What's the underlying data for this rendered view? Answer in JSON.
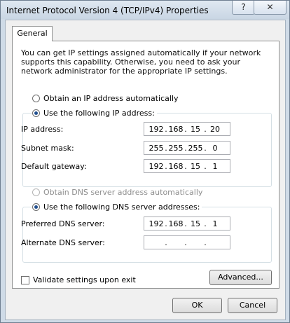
{
  "window": {
    "title": "Internet Protocol Version 4 (TCP/IPv4) Properties",
    "help_label": "?",
    "close_label": "✕"
  },
  "tabs": [
    {
      "label": "General"
    }
  ],
  "description": "You can get IP settings assigned automatically if your network supports this capability. Otherwise, you need to ask your network administrator for the appropriate IP settings.",
  "ip": {
    "auto_label": "Obtain an IP address automatically",
    "manual_label": "Use the following IP address:",
    "selected": "manual",
    "fields": [
      {
        "label": "IP address:",
        "octets": [
          "192",
          "168",
          "15",
          "20"
        ]
      },
      {
        "label": "Subnet mask:",
        "octets": [
          "255",
          "255",
          "255",
          "0"
        ]
      },
      {
        "label": "Default gateway:",
        "octets": [
          "192",
          "168",
          "15",
          "1"
        ]
      }
    ]
  },
  "dns": {
    "auto_label": "Obtain DNS server address automatically",
    "auto_disabled": true,
    "manual_label": "Use the following DNS server addresses:",
    "selected": "manual",
    "fields": [
      {
        "label": "Preferred DNS server:",
        "octets": [
          "192",
          "168",
          "15",
          "1"
        ]
      },
      {
        "label": "Alternate DNS server:",
        "octets": [
          "",
          "",
          "",
          ""
        ]
      }
    ]
  },
  "validate": {
    "label": "Validate settings upon exit",
    "checked": false
  },
  "buttons": {
    "advanced": "Advanced...",
    "ok": "OK",
    "cancel": "Cancel"
  },
  "icons": {
    "help": "help-icon",
    "close": "close-icon"
  },
  "colors": {
    "radio_dot": "#214f8e",
    "title_gradient_top": "#dfe8f1",
    "title_gradient_bottom": "#c9d6e4"
  }
}
